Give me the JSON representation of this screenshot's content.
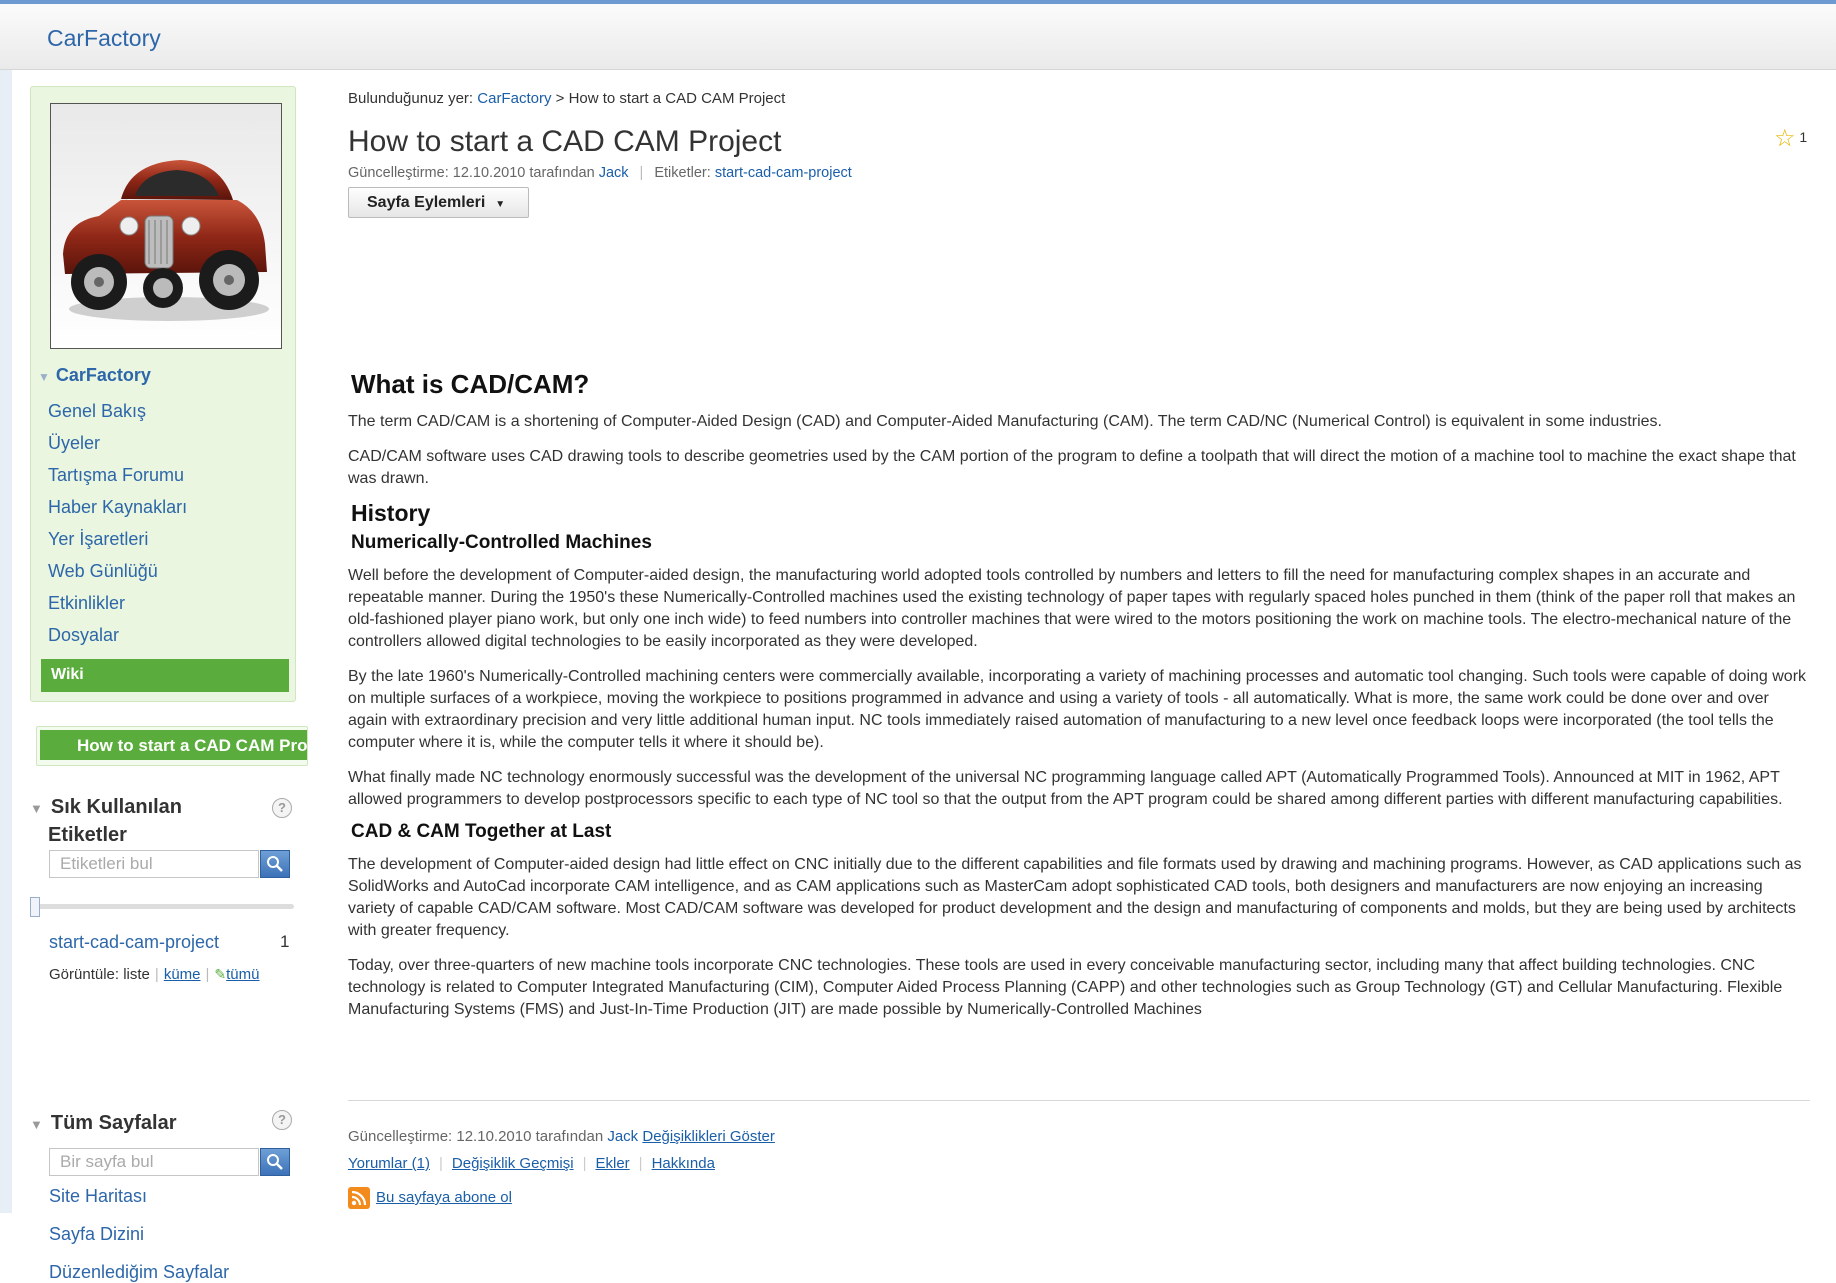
{
  "header": {
    "app_title": "CarFactory"
  },
  "sidebar": {
    "group_title": "CarFactory",
    "nav_items": [
      {
        "label": "Genel Bakış"
      },
      {
        "label": "Üyeler"
      },
      {
        "label": "Tartışma Forumu"
      },
      {
        "label": "Haber Kaynakları"
      },
      {
        "label": "Yer İşaretleri"
      },
      {
        "label": "Web Günlüğü"
      },
      {
        "label": "Etkinlikler"
      },
      {
        "label": "Dosyalar"
      }
    ],
    "active_item": "Wiki",
    "current_page": "How to start a CAD CAM Project",
    "tags_section": {
      "title_line1": "Sık Kullanılan",
      "title_line2": "Etiketler",
      "help": "?",
      "search_placeholder": "Etiketleri bul",
      "tags": [
        {
          "name": "start-cad-cam-project",
          "count": "1"
        }
      ],
      "view_label": "Görüntüle:",
      "view_list": "liste",
      "view_cloud": "küme",
      "view_all": "tümü"
    },
    "pages_section": {
      "title": "Tüm Sayfalar",
      "help": "?",
      "search_placeholder": "Bir sayfa bul",
      "links": [
        "Site Haritası",
        "Sayfa Dizini",
        "Düzenlediğim Sayfalar"
      ]
    }
  },
  "main": {
    "breadcrumb_label": "Bulunduğunuz yer:",
    "breadcrumb_link": "CarFactory",
    "breadcrumb_sep": ">",
    "breadcrumb_current": "How to start a CAD CAM Project",
    "title": "How to start a CAD CAM Project",
    "star_count": "1",
    "updated_prefix": "Güncelleştirme: 12.10.2010 tarafından",
    "updated_author": "Jack",
    "tags_label": "Etiketler:",
    "tags_value": "start-cad-cam-project",
    "page_actions_label": "Sayfa Eylemleri",
    "content": {
      "h_what": "What is CAD/CAM?",
      "p1": "The term CAD/CAM is a shortening of Computer-Aided Design (CAD) and Computer-Aided Manufacturing (CAM). The term CAD/NC (Numerical Control) is equivalent in some industries.",
      "p2": "CAD/CAM software uses CAD drawing tools to describe geometries used by the CAM portion of the program to define a toolpath that will direct the motion of a machine tool to machine the exact shape that was drawn.",
      "h_history": "History",
      "h_nc": "Numerically-Controlled Machines",
      "p3": "Well before the development of Computer-aided design, the manufacturing world adopted tools controlled by numbers and letters to fill the need for manufacturing complex shapes in an accurate and repeatable manner. During the 1950's these Numerically-Controlled machines used the existing technology of paper tapes with regularly spaced holes punched in them (think of the paper roll that makes an old-fashioned player piano work, but only one inch wide) to feed numbers into controller machines that were wired to the motors positioning the work on machine tools. The electro-mechanical nature of the controllers allowed digital technologies to be easily incorporated as they were developed.",
      "p4": "By the late 1960's Numerically-Controlled machining centers were commercially available, incorporating a variety of machining processes and automatic tool changing. Such tools were capable of doing work on multiple surfaces of a workpiece, moving the workpiece to positions programmed in advance and using a variety of tools - all automatically. What is more, the same work could be done over and over again with extraordinary precision and very little additional human input. NC tools immediately raised automation of manufacturing to a new level once feedback loops were incorporated (the tool tells the computer where it is, while the computer tells it where it should be).",
      "p5": "What finally made NC technology enormously successful was the development of the universal NC programming language called APT (Automatically Programmed Tools). Announced at MIT in 1962, APT allowed programmers to develop postprocessors specific to each type of NC tool so that the output from the APT program could be shared among different parties with different manufacturing capabilities.",
      "h_together": "CAD & CAM Together at Last",
      "p6": "The development of Computer-aided design had little effect on CNC initially due to the different capabilities and file formats used by drawing and machining programs. However, as CAD applications such as SolidWorks and AutoCad incorporate CAM intelligence, and as CAM applications such as MasterCam adopt sophisticated CAD tools, both designers and manufacturers are now enjoying an increasing variety of capable CAD/CAM software. Most CAD/CAM software was developed for product development and the design and manufacturing of components and molds, but they are being used by architects with greater frequency.",
      "p7": "Today, over three-quarters of new machine tools incorporate CNC technologies. These tools are used in every conceivable manufacturing sector, including many that affect building technologies. CNC technology is related to Computer Integrated Manufacturing (CIM), Computer Aided Process Planning (CAPP) and other technologies such as Group Technology (GT) and Cellular Manufacturing. Flexible Manufacturing Systems (FMS) and Just-In-Time Production (JIT) are made possible by Numerically-Controlled Machines"
    },
    "footer": {
      "updated_prefix": "Güncelleştirme: 12.10.2010 tarafından",
      "updated_author": "Jack",
      "show_changes": "Değişiklikleri Göster",
      "comments": "Yorumlar (1)",
      "history": "Değişiklik Geçmişi",
      "attachments": "Ekler",
      "about": "Hakkında",
      "subscribe": "Bu sayfaya abone ol"
    }
  },
  "colors": {
    "accent": "#2d67a9",
    "active_green": "#5aad3c",
    "nav_bg": "#eaf6e0"
  }
}
